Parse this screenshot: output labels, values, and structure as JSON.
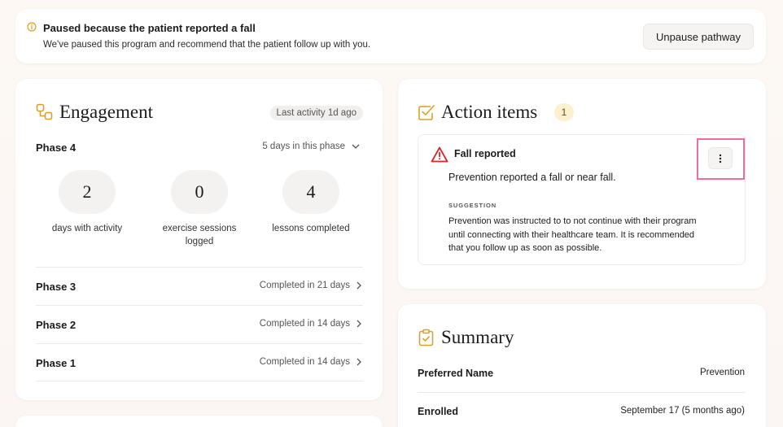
{
  "banner": {
    "title": "Paused because the patient reported a fall",
    "subtitle": "We've paused this program and recommend that the patient follow up with you.",
    "unpause_label": "Unpause pathway",
    "icon": "info-circle-icon"
  },
  "engagement": {
    "title": "Engagement",
    "last_activity": "Last activity 1d ago",
    "current_phase": {
      "label": "Phase 4",
      "meta": "5 days in this phase",
      "stats": [
        {
          "value": "2",
          "label": "days with activity"
        },
        {
          "value": "0",
          "label": "exercise sessions logged"
        },
        {
          "value": "4",
          "label": "lessons completed"
        }
      ]
    },
    "phases": [
      {
        "label": "Phase 3",
        "meta": "Completed in 21 days"
      },
      {
        "label": "Phase 2",
        "meta": "Completed in 14 days"
      },
      {
        "label": "Phase 1",
        "meta": "Completed in 14 days"
      }
    ]
  },
  "actions": {
    "title": "Action items",
    "count": "1",
    "item": {
      "title": "Fall reported",
      "description": "Prevention reported a fall or near fall.",
      "suggestion_label": "SUGGESTION",
      "suggestion_text": "Prevention was instructed to to not continue with their program until connecting with their healthcare team. It is recommended that you follow up as soon as possible."
    }
  },
  "summary": {
    "title": "Summary",
    "rows": [
      {
        "key": "Preferred Name",
        "value": "Prevention"
      },
      {
        "key": "Enrolled",
        "value": "September 17 (5 months ago)"
      }
    ]
  },
  "colors": {
    "accent": "#e0a01f",
    "warning": "#d9262c",
    "highlight": "#ed6f94"
  }
}
